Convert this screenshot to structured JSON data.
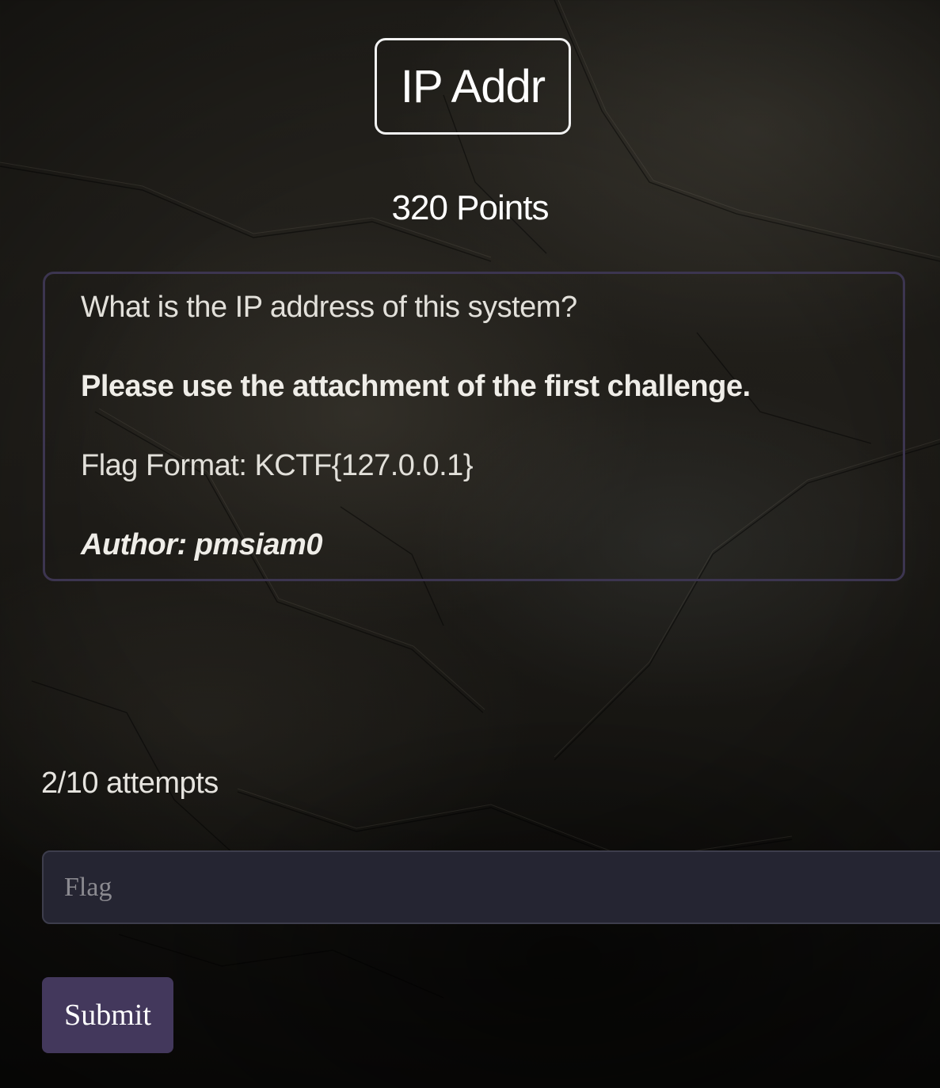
{
  "challenge": {
    "title": "IP Addr",
    "points": "320 Points"
  },
  "description": {
    "question": "What is the IP address of this system?",
    "note": "Please use the attachment of the first challenge.",
    "flag_format": "Flag Format: KCTF{127.0.0.1}",
    "author": "Author: pmsiam0"
  },
  "attempts": "2/10 attempts",
  "flag_input": {
    "placeholder": "Flag",
    "value": ""
  },
  "submit_label": "Submit",
  "colors": {
    "background": "#1b1915",
    "accent": "#43385c",
    "panel_border": "#3c3550",
    "input_background": "#252532"
  }
}
